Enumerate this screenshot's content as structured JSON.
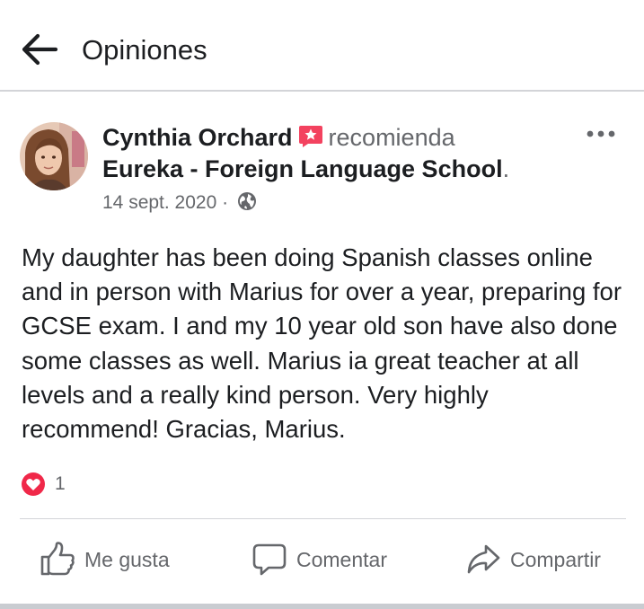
{
  "header": {
    "back_icon": "arrow-left-icon",
    "title": "Opiniones"
  },
  "post": {
    "author": "Cynthia Orchard",
    "recommend_icon": "recommend-badge-icon",
    "verb": "recomienda",
    "page_name": "Eureka - Foreign Language School",
    "page_suffix": ".",
    "date": "14 sept. 2020",
    "separator": " · ",
    "privacy_icon": "globe-icon",
    "more_icon": "more-options-icon",
    "text": "My daughter has been doing Spanish classes online and in person with Marius for over a year, preparing for GCSE exam. I and my 10 year old son have also done some classes as well. Marius ia great teacher at all levels and a really kind person. Very highly recommend! Gracias, Marius.",
    "reactions": {
      "icon": "love-reaction-icon",
      "count": "1"
    }
  },
  "actions": {
    "like": {
      "label": "Me gusta",
      "icon": "thumbs-up-icon"
    },
    "comment": {
      "label": "Comentar",
      "icon": "comment-bubble-icon"
    },
    "share": {
      "label": "Compartir",
      "icon": "share-arrow-icon"
    }
  },
  "colors": {
    "text": "#1c1e21",
    "secondary": "#65676b",
    "divider": "#d3d4d8",
    "recommend": "#f3425f",
    "love": "#f02849"
  }
}
